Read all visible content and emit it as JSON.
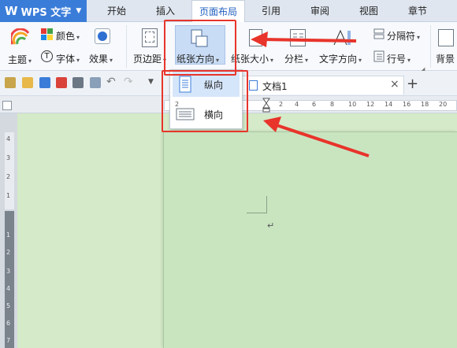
{
  "app": {
    "name": "WPS 文字"
  },
  "tabs": [
    {
      "label": "开始",
      "active": false
    },
    {
      "label": "插入",
      "active": false
    },
    {
      "label": "页面布局",
      "active": true
    },
    {
      "label": "引用",
      "active": false
    },
    {
      "label": "审阅",
      "active": false
    },
    {
      "label": "视图",
      "active": false
    },
    {
      "label": "章节",
      "active": false
    }
  ],
  "ribbon": {
    "theme": "主题",
    "color": "颜色",
    "font": "字体",
    "effect": "效果",
    "margins": "页边距",
    "orientation": "纸张方向",
    "size": "纸张大小",
    "columns": "分栏",
    "text_direction": "文字方向",
    "separator": "分隔符",
    "line_number": "行号",
    "background": "背景"
  },
  "document": {
    "tab_title": "文档1",
    "close_glyph": "×",
    "add_glyph": "+"
  },
  "dropdown": {
    "portrait": "纵向",
    "landscape": "横向"
  },
  "ruler": {
    "h_labels": [
      "2",
      "2",
      "4",
      "6",
      "8",
      "10",
      "12",
      "14",
      "16",
      "18",
      "20"
    ],
    "v_labels": [
      "4",
      "3",
      "2",
      "1",
      "1",
      "2",
      "3",
      "4",
      "5",
      "6",
      "7"
    ]
  },
  "colors": {
    "accent": "#3a7dd9",
    "highlight": "#e8342b",
    "page": "#c9e5c0"
  },
  "icons": [
    "theme-icon",
    "color-icon",
    "effect-icon",
    "margins-icon",
    "orientation-icon",
    "size-icon",
    "columns-icon",
    "text-direction-icon",
    "separator-icon",
    "line-number-icon",
    "background-icon"
  ]
}
